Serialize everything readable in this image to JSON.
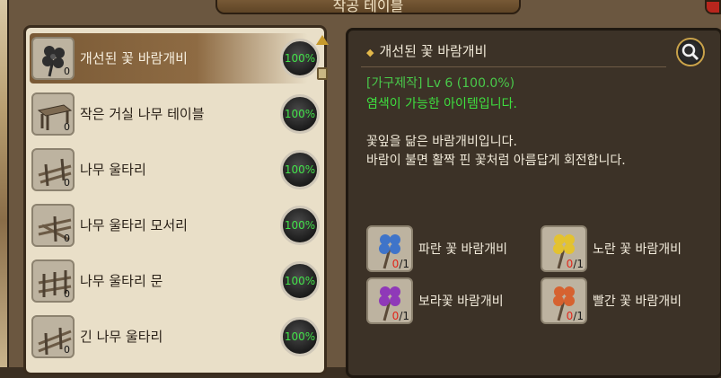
{
  "window": {
    "title": "작공 테이블"
  },
  "list": {
    "items": [
      {
        "name": "개선된 꽃 바람개비",
        "count": "0",
        "percent": "100%",
        "icon": "pinwheel-icon"
      },
      {
        "name": "작은 거실 나무 테이블",
        "count": "0",
        "percent": "100%",
        "icon": "table-icon"
      },
      {
        "name": "나무 울타리",
        "count": "0",
        "percent": "100%",
        "icon": "fence-icon"
      },
      {
        "name": "나무 울타리 모서리",
        "count": "0",
        "percent": "100%",
        "icon": "fence-corner-icon"
      },
      {
        "name": "나무 울타리 문",
        "count": "0",
        "percent": "100%",
        "icon": "fence-gate-icon"
      },
      {
        "name": "긴 나무 울타리",
        "count": "0",
        "percent": "100%",
        "icon": "long-fence-icon"
      }
    ]
  },
  "detail": {
    "title": "개선된 꽃 바람개비",
    "craft_info": "[가구제작] Lv 6 (100.0%)",
    "dye_info": "염색이 가능한 아이템입니다.",
    "description": [
      "꽃잎을 닮은 바람개비입니다.",
      "바람이 불면 활짝 핀 꽃처럼 아름답게 회전합니다."
    ],
    "materials": [
      {
        "name": "파란 꽃 바람개비",
        "have": "0",
        "need": "/1",
        "color": "#3f74c9"
      },
      {
        "name": "노란 꽃 바람개비",
        "have": "0",
        "need": "/1",
        "color": "#e3c230"
      },
      {
        "name": "보라꽃 바람개비",
        "have": "0",
        "need": "/1",
        "color": "#8f39b8"
      },
      {
        "name": "빨간 꽃 바람개비",
        "have": "0",
        "need": "/1",
        "color": "#d66230"
      }
    ]
  },
  "colors": {
    "percent_text": "#43e24a",
    "craft_text": "#49c94a",
    "missing_count": "#e2261a"
  }
}
